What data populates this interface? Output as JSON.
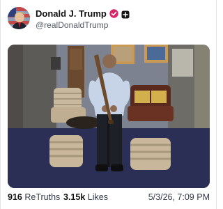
{
  "post": {
    "author": {
      "display_name": "Donald J. Trump",
      "handle": "@realDonaldTrump",
      "verified_color": "#d7266a"
    },
    "media": {
      "alt": "photo"
    },
    "stats": {
      "retruths_count": "916",
      "retruths_label": "ReTruths",
      "likes_count": "3.15k",
      "likes_label": "Likes"
    },
    "timestamp": "5/3/26, 7:09 PM"
  }
}
